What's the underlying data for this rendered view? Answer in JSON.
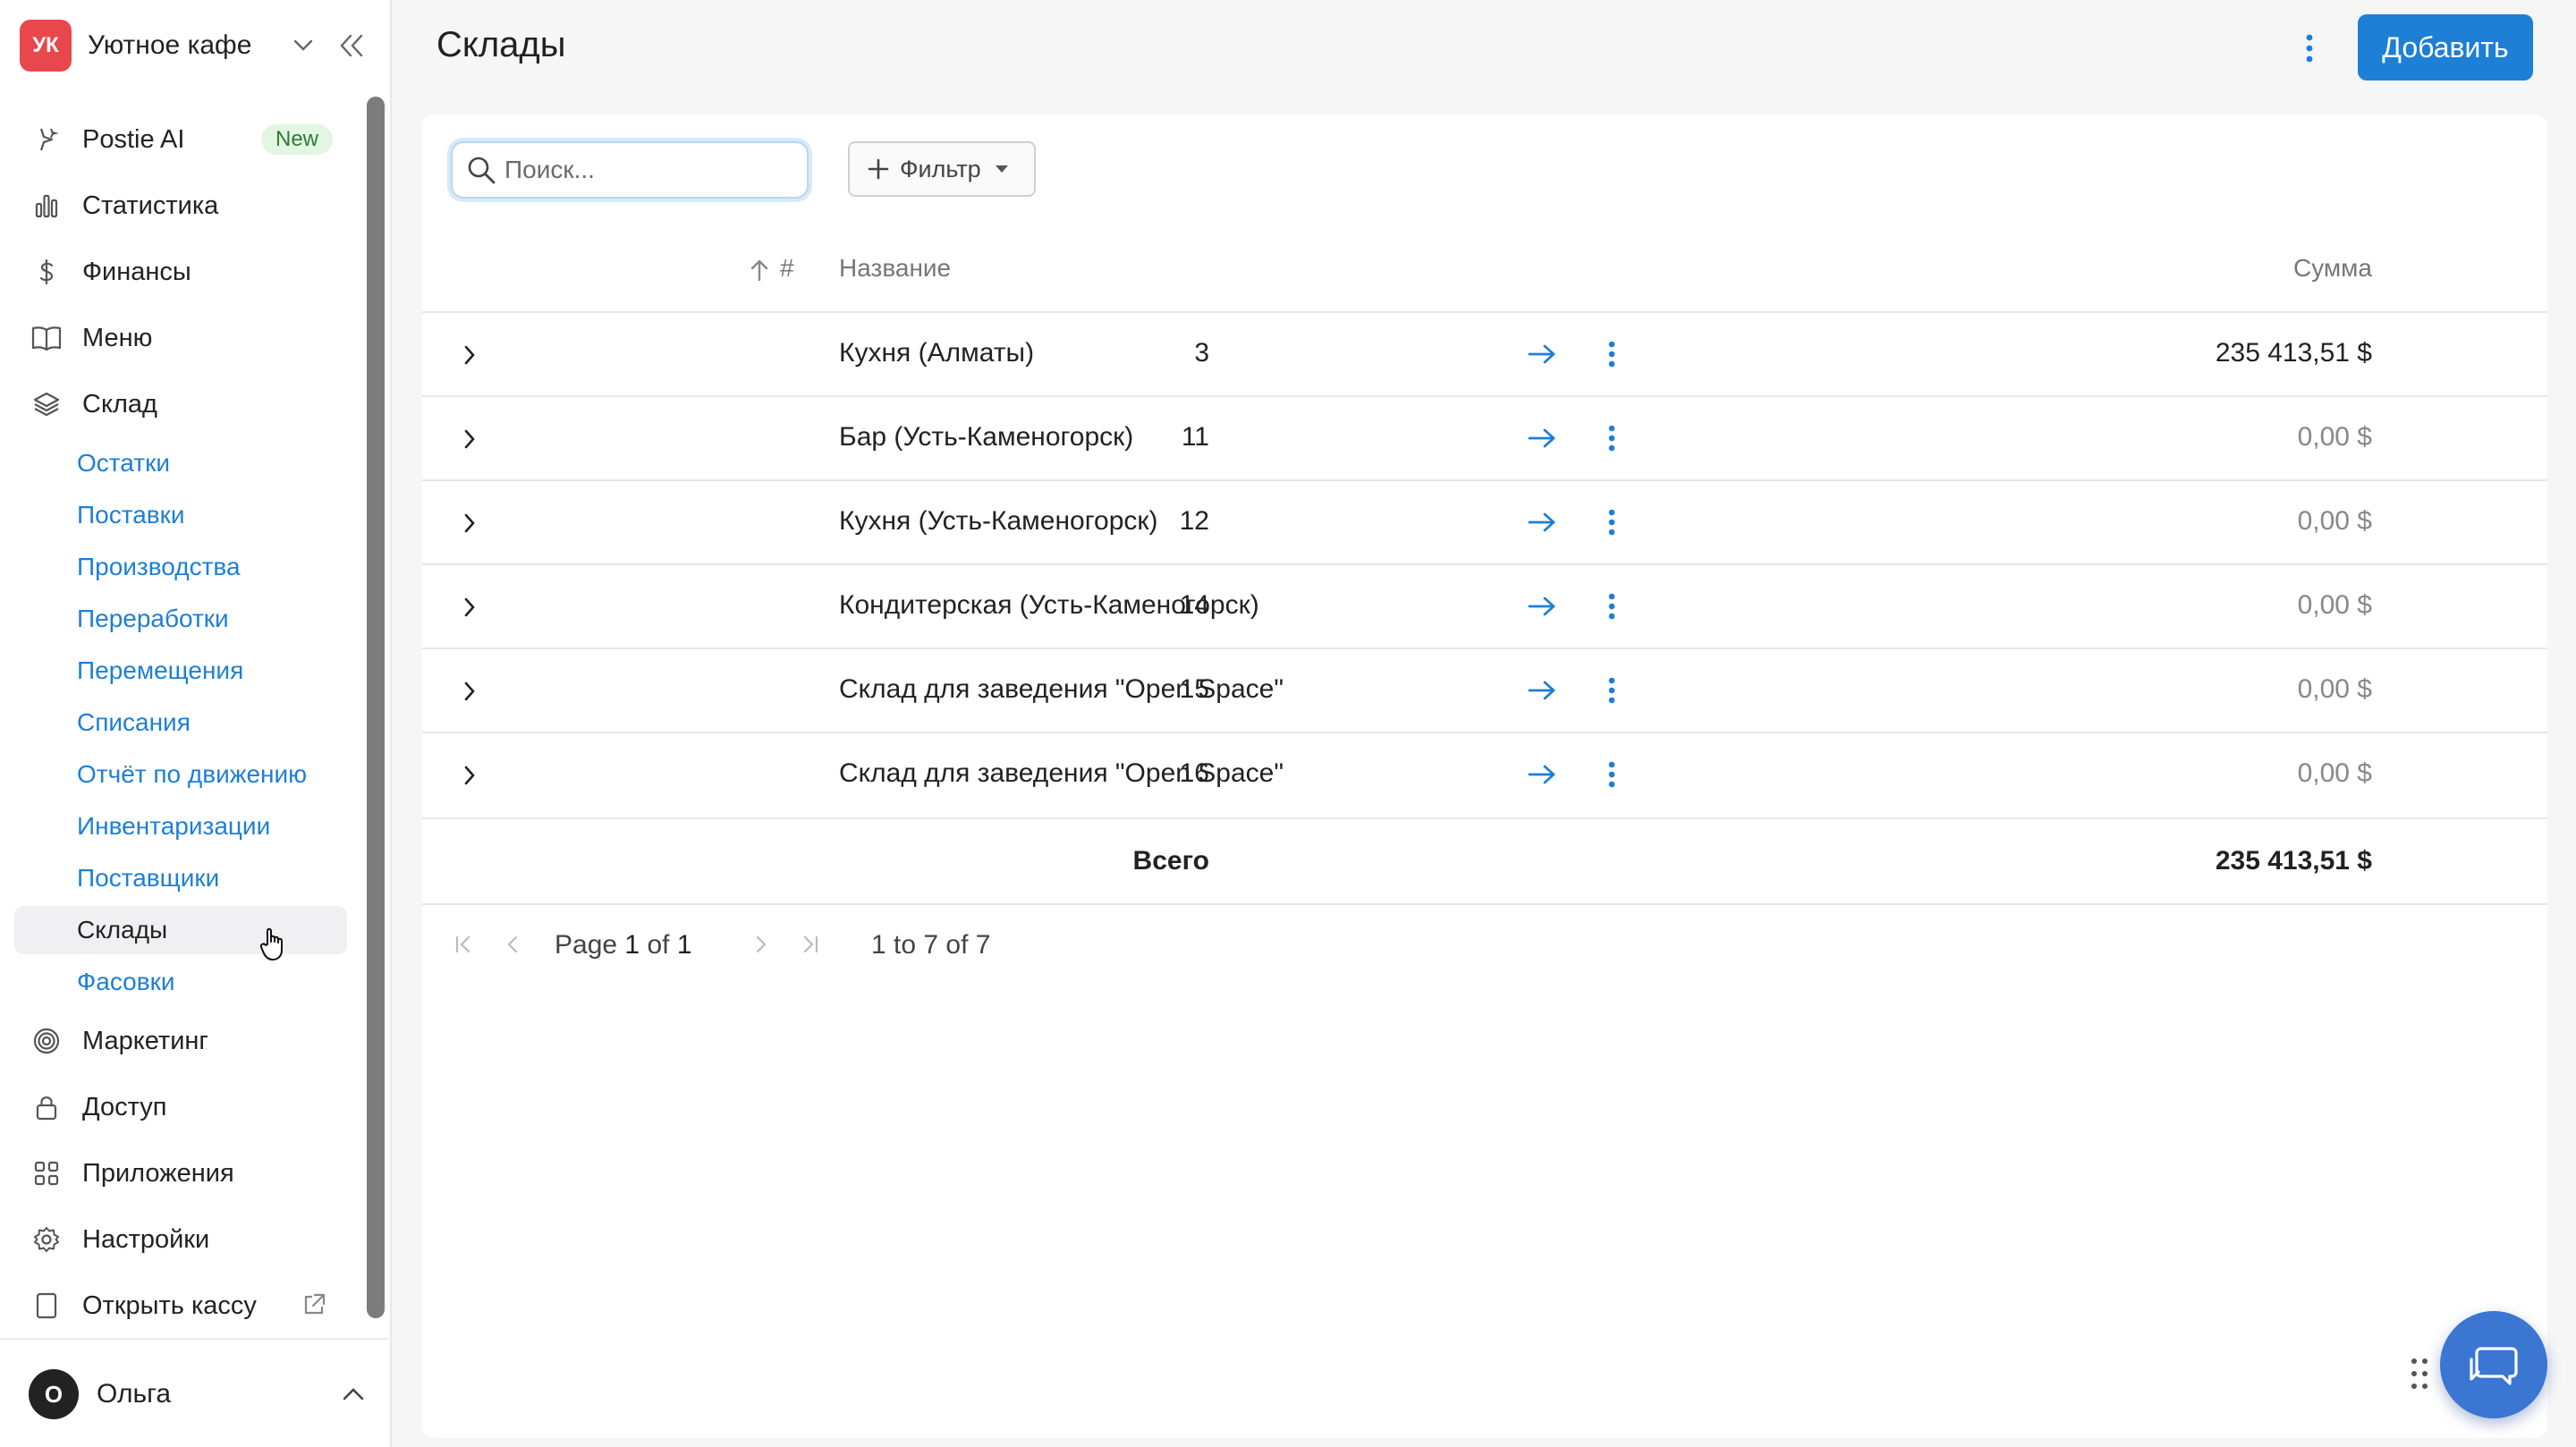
{
  "brand": {
    "initials": "УК",
    "name": "Уютное кафе",
    "color": "#e8474c"
  },
  "nav": {
    "postie": "Postie AI",
    "postie_badge": "New",
    "stats": "Статистика",
    "finance": "Финансы",
    "menu": "Меню",
    "warehouse": "Склад",
    "marketing": "Маркетинг",
    "access": "Доступ",
    "apps": "Приложения",
    "settings": "Настройки",
    "open_register": "Открыть кассу"
  },
  "warehouse_sub": [
    {
      "label": "Остатки"
    },
    {
      "label": "Поставки"
    },
    {
      "label": "Производства"
    },
    {
      "label": "Переработки"
    },
    {
      "label": "Перемещения"
    },
    {
      "label": "Списания"
    },
    {
      "label": "Отчёт по движению"
    },
    {
      "label": "Инвентаризации"
    },
    {
      "label": "Поставщики"
    },
    {
      "label": "Склады"
    },
    {
      "label": "Фасовки"
    }
  ],
  "user": {
    "initial": "О",
    "name": "Ольга"
  },
  "page": {
    "title": "Склады",
    "add_label": "Добавить"
  },
  "toolbar": {
    "search_placeholder": "Поиск...",
    "search_value": "",
    "filter_label": "Фильтр"
  },
  "table": {
    "columns": {
      "num": "#",
      "name": "Название",
      "sum": "Сумма"
    },
    "rows": [
      {
        "num": "3",
        "name": "Кухня (Алматы)",
        "sum": "235 413,51 $"
      },
      {
        "num": "11",
        "name": "Бар (Усть-Каменогорск)",
        "sum": "0,00 $"
      },
      {
        "num": "12",
        "name": "Кухня (Усть-Каменогорск)",
        "sum": "0,00 $"
      },
      {
        "num": "14",
        "name": "Кондитерская (Усть-Каменогорск)",
        "sum": "0,00 $"
      },
      {
        "num": "15",
        "name": "Склад для заведения \"Open Space\"",
        "sum": "0,00 $"
      },
      {
        "num": "16",
        "name": "Склад для заведения \"Open Space\"",
        "sum": "0,00 $"
      }
    ],
    "total_label": "Всего",
    "total_sum": "235 413,51 $"
  },
  "pagination": {
    "page_prefix": "Page",
    "page_current": "1",
    "page_of": "of",
    "page_total": "1",
    "range": "1 to 7 of 7"
  },
  "colors": {
    "accent": "#1d7fd6",
    "chat": "#3a76d2"
  },
  "icons": {
    "postie": "sparkle-icon",
    "stats": "bar-chart-icon",
    "finance": "dollar-icon",
    "menu": "book-icon",
    "warehouse": "layers-icon",
    "marketing": "target-icon",
    "access": "lock-icon",
    "apps": "grid-icon",
    "settings": "gear-icon",
    "open_register": "tablet-icon"
  }
}
